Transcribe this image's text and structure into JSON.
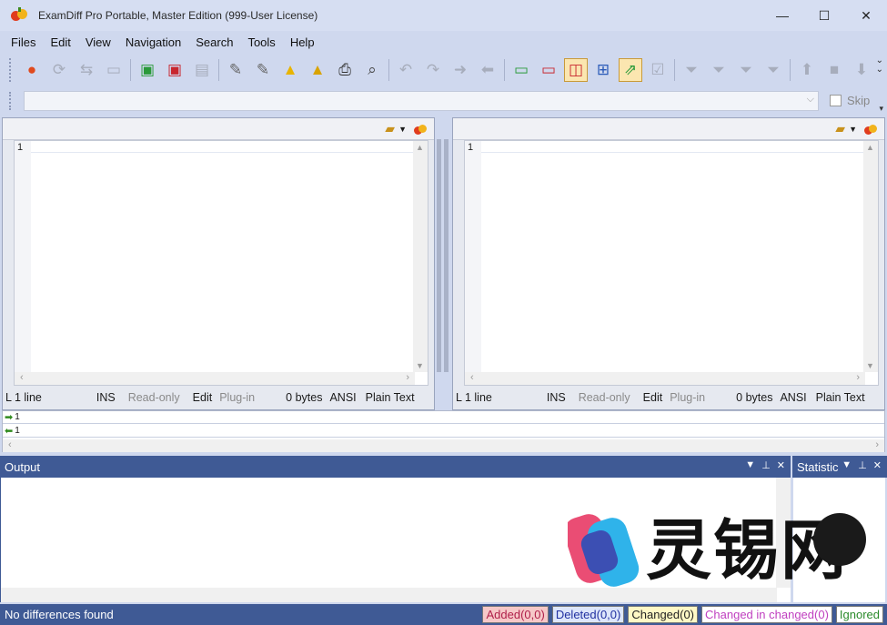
{
  "window": {
    "title": "ExamDiff Pro Portable, Master Edition (999-User License)",
    "minimize": "—",
    "maximize": "☐",
    "close": "✕"
  },
  "menu": [
    "Files",
    "Edit",
    "View",
    "Navigation",
    "Search",
    "Tools",
    "Help"
  ],
  "toolbar": {
    "icons": [
      "compare-icon",
      "refresh-icon",
      "swap-icon",
      "open-folder-icon",
      "save-green-icon",
      "save-red-icon",
      "save-all-icon",
      "edit-left-icon",
      "edit-right-icon",
      "warning-icon",
      "options-icon",
      "print-icon",
      "zoom-icon",
      "undo-icon",
      "redo-icon",
      "next-icon",
      "prev-icon",
      "view-single-icon",
      "view-single-red-icon",
      "view-side-by-side-icon",
      "view-grid-icon",
      "sync-icon",
      "checkbox-icon",
      "filter-1-icon",
      "filter-2-icon",
      "filter-3-icon",
      "filter-4-icon",
      "up-icon",
      "stop-icon",
      "down-icon"
    ]
  },
  "filter": {
    "value": "",
    "skip_label": "Skip"
  },
  "left_pane": {
    "line_number": "1",
    "status": {
      "lines": "L  1 line",
      "ins": "INS",
      "readonly": "Read-only",
      "edit": "Edit",
      "plugin": "Plug-in",
      "size": "0 bytes",
      "encoding": "ANSI",
      "syntax": "Plain Text"
    }
  },
  "right_pane": {
    "line_number": "1",
    "status": {
      "lines": "L  1 line",
      "ins": "INS",
      "readonly": "Read-only",
      "edit": "Edit",
      "plugin": "Plug-in",
      "size": "0 bytes",
      "encoding": "ANSI",
      "syntax": "Plain Text"
    }
  },
  "diff_map": {
    "row1": "1",
    "row2": "1"
  },
  "output_panel": {
    "title": "Output"
  },
  "statistic_panel": {
    "title": "Statistic"
  },
  "watermark": {
    "text": "灵锡网"
  },
  "statusbar": {
    "message": "No differences found",
    "added": "Added(0,0)",
    "deleted": "Deleted(0,0)",
    "changed": "Changed(0)",
    "changed_in_changed": "Changed in changed(0)",
    "ignored": "Ignored"
  },
  "colors": {
    "added_bg": "#f6c8c8",
    "deleted_bg": "#dde6fb",
    "changed_bg": "#fff8c6",
    "changed_in_changed_bg": "#ffffff",
    "ignored_bg": "#ffffff"
  }
}
